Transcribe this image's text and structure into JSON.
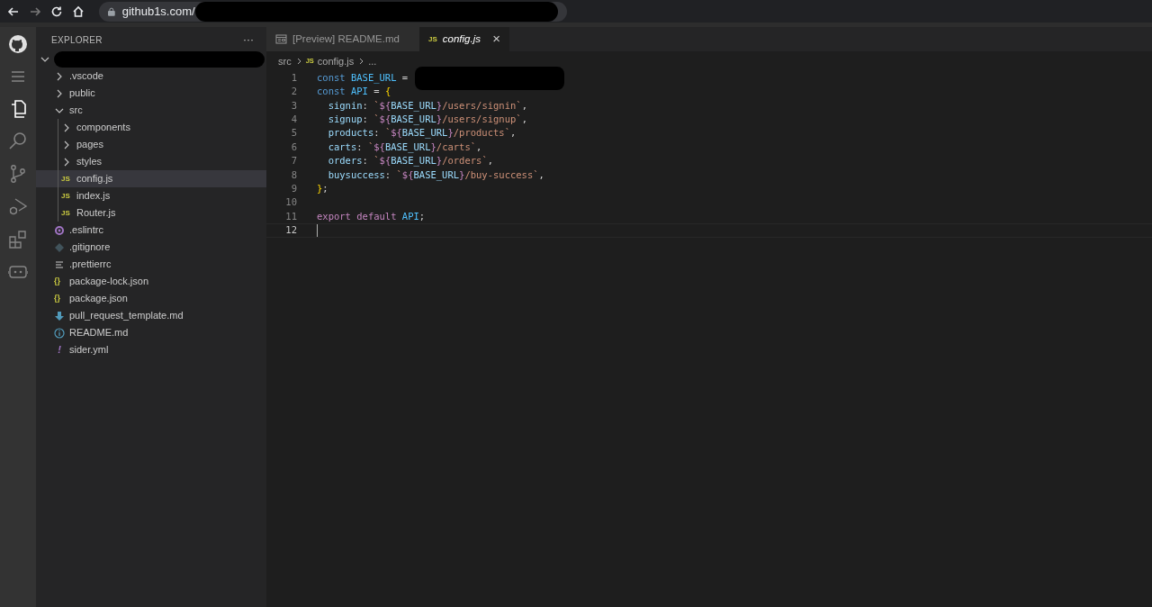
{
  "browser": {
    "url": "github1s.com/"
  },
  "activity_bar": [
    {
      "kind": "github",
      "selected": false
    },
    {
      "kind": "menu",
      "selected": false
    },
    {
      "kind": "files",
      "selected": true
    },
    {
      "kind": "search",
      "selected": false
    },
    {
      "kind": "scm",
      "selected": false
    },
    {
      "kind": "debug",
      "selected": false
    },
    {
      "kind": "extensions",
      "selected": false
    },
    {
      "kind": "bot",
      "selected": false
    }
  ],
  "sidebar": {
    "title": "EXPLORER",
    "more": "···",
    "root": {
      "expanded": true,
      "children": [
        {
          "label": ".vscode",
          "kind": "folder",
          "expanded": false,
          "selected": false
        },
        {
          "label": "public",
          "kind": "folder",
          "expanded": false,
          "selected": false
        },
        {
          "label": "src",
          "kind": "folder",
          "expanded": true,
          "selected": false,
          "children": [
            {
              "label": "components",
              "kind": "folder",
              "expanded": false,
              "selected": false
            },
            {
              "label": "pages",
              "kind": "folder",
              "expanded": false,
              "selected": false
            },
            {
              "label": "styles",
              "kind": "folder",
              "expanded": false,
              "selected": false
            },
            {
              "label": "config.js",
              "kind": "js",
              "badge": "JS",
              "selected": true
            },
            {
              "label": "index.js",
              "kind": "js",
              "badge": "JS",
              "selected": false
            },
            {
              "label": "Router.js",
              "kind": "js",
              "badge": "JS",
              "selected": false
            }
          ]
        },
        {
          "label": ".eslintrc",
          "kind": "eslint",
          "selected": false
        },
        {
          "label": ".gitignore",
          "kind": "git",
          "selected": false
        },
        {
          "label": ".prettierrc",
          "kind": "lines",
          "selected": false
        },
        {
          "label": "package-lock.json",
          "kind": "json",
          "badge": "{}",
          "selected": false
        },
        {
          "label": "package.json",
          "kind": "json",
          "badge": "{}",
          "selected": false
        },
        {
          "label": "pull_request_template.md",
          "kind": "download",
          "selected": false
        },
        {
          "label": "README.md",
          "kind": "info",
          "selected": false
        },
        {
          "label": "sider.yml",
          "kind": "yaml",
          "badge": "!",
          "selected": false
        }
      ]
    }
  },
  "tabs": [
    {
      "label": "[Preview] README.md",
      "kind": "preview",
      "selected": false,
      "italic": false
    },
    {
      "label": "config.js",
      "kind": "js",
      "badge": "JS",
      "selected": true,
      "italic": true,
      "close": "×"
    }
  ],
  "breadcrumb": [
    {
      "label": "src"
    },
    {
      "label": "config.js",
      "kind": "js",
      "badge": "JS"
    },
    {
      "label": "..."
    }
  ],
  "code": [
    {
      "number": "1",
      "current": false,
      "segments": [
        {
          "kind": "keyword",
          "text": "const "
        },
        {
          "kind": "constant",
          "text": "BASE_URL"
        },
        {
          "kind": "plain",
          "text": " = "
        }
      ]
    },
    {
      "number": "2",
      "current": false,
      "segments": [
        {
          "kind": "keyword",
          "text": "const "
        },
        {
          "kind": "constant",
          "text": "API"
        },
        {
          "kind": "plain",
          "text": " = "
        },
        {
          "kind": "bracket",
          "text": "{"
        }
      ]
    },
    {
      "number": "3",
      "current": false,
      "segments": [
        {
          "kind": "prop",
          "text": "  signin"
        },
        {
          "kind": "plain",
          "text": ": "
        },
        {
          "kind": "string",
          "text": "`"
        },
        {
          "kind": "interp",
          "text": "${"
        },
        {
          "kind": "prop",
          "text": "BASE_URL"
        },
        {
          "kind": "interp",
          "text": "}"
        },
        {
          "kind": "string",
          "text": "/users/signin`"
        },
        {
          "kind": "plain",
          "text": ","
        }
      ]
    },
    {
      "number": "4",
      "current": false,
      "segments": [
        {
          "kind": "prop",
          "text": "  signup"
        },
        {
          "kind": "plain",
          "text": ": "
        },
        {
          "kind": "string",
          "text": "`"
        },
        {
          "kind": "interp",
          "text": "${"
        },
        {
          "kind": "prop",
          "text": "BASE_URL"
        },
        {
          "kind": "interp",
          "text": "}"
        },
        {
          "kind": "string",
          "text": "/users/signup`"
        },
        {
          "kind": "plain",
          "text": ","
        }
      ]
    },
    {
      "number": "5",
      "current": false,
      "segments": [
        {
          "kind": "prop",
          "text": "  products"
        },
        {
          "kind": "plain",
          "text": ": "
        },
        {
          "kind": "string",
          "text": "`"
        },
        {
          "kind": "interp",
          "text": "${"
        },
        {
          "kind": "prop",
          "text": "BASE_URL"
        },
        {
          "kind": "interp",
          "text": "}"
        },
        {
          "kind": "string",
          "text": "/products`"
        },
        {
          "kind": "plain",
          "text": ","
        }
      ]
    },
    {
      "number": "6",
      "current": false,
      "segments": [
        {
          "kind": "prop",
          "text": "  carts"
        },
        {
          "kind": "plain",
          "text": ": "
        },
        {
          "kind": "string",
          "text": "`"
        },
        {
          "kind": "interp",
          "text": "${"
        },
        {
          "kind": "prop",
          "text": "BASE_URL"
        },
        {
          "kind": "interp",
          "text": "}"
        },
        {
          "kind": "string",
          "text": "/carts`"
        },
        {
          "kind": "plain",
          "text": ","
        }
      ]
    },
    {
      "number": "7",
      "current": false,
      "segments": [
        {
          "kind": "prop",
          "text": "  orders"
        },
        {
          "kind": "plain",
          "text": ": "
        },
        {
          "kind": "string",
          "text": "`"
        },
        {
          "kind": "interp",
          "text": "${"
        },
        {
          "kind": "prop",
          "text": "BASE_URL"
        },
        {
          "kind": "interp",
          "text": "}"
        },
        {
          "kind": "string",
          "text": "/orders`"
        },
        {
          "kind": "plain",
          "text": ","
        }
      ]
    },
    {
      "number": "8",
      "current": false,
      "segments": [
        {
          "kind": "prop",
          "text": "  buysuccess"
        },
        {
          "kind": "plain",
          "text": ": "
        },
        {
          "kind": "string",
          "text": "`"
        },
        {
          "kind": "interp",
          "text": "${"
        },
        {
          "kind": "prop",
          "text": "BASE_URL"
        },
        {
          "kind": "interp",
          "text": "}"
        },
        {
          "kind": "string",
          "text": "/buy-success`"
        },
        {
          "kind": "plain",
          "text": ","
        }
      ]
    },
    {
      "number": "9",
      "current": false,
      "segments": [
        {
          "kind": "bracket",
          "text": "}"
        },
        {
          "kind": "plain",
          "text": ";"
        }
      ]
    },
    {
      "number": "10",
      "current": false
    },
    {
      "number": "11",
      "current": false,
      "segments": [
        {
          "kind": "control",
          "text": "export default "
        },
        {
          "kind": "constant",
          "text": "API"
        },
        {
          "kind": "plain",
          "text": ";"
        }
      ]
    },
    {
      "number": "12",
      "current": true
    }
  ]
}
